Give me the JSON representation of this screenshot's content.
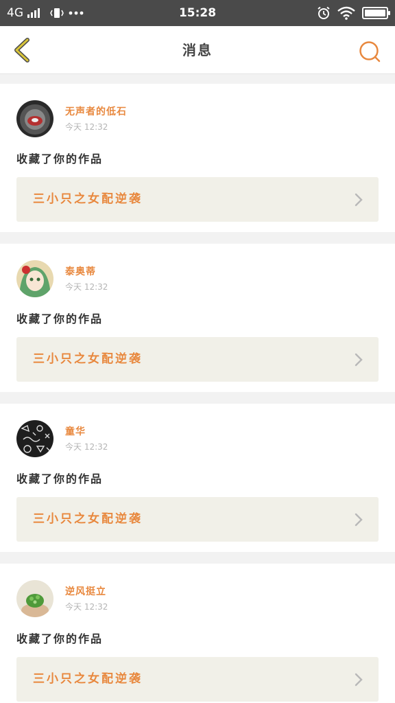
{
  "status_bar": {
    "network": "4G",
    "time": "15:28"
  },
  "header": {
    "title": "消息",
    "back_icon": "chevron-left-icon",
    "search_icon": "search-icon"
  },
  "colors": {
    "accent": "#e8883e",
    "back_icon": "#d8c43a",
    "status_bar_bg": "#4a4a4a",
    "work_box_bg": "#f1f0e8"
  },
  "messages": [
    {
      "username": "无声者的低石",
      "time": "今天 12:32",
      "action": "收藏了你的作品",
      "work_title": "三小只之女配逆袭"
    },
    {
      "username": "泰奥蒂",
      "time": "今天 12:32",
      "action": "收藏了你的作品",
      "work_title": "三小只之女配逆袭"
    },
    {
      "username": "童华",
      "time": "今天 12:32",
      "action": "收藏了你的作品",
      "work_title": "三小只之女配逆袭"
    },
    {
      "username": "逆风挺立",
      "time": "今天 12:32",
      "action": "收藏了你的作品",
      "work_title": "三小只之女配逆袭"
    }
  ]
}
